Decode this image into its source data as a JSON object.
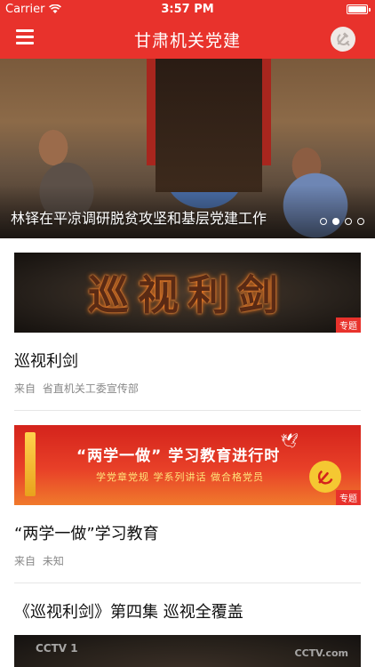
{
  "status_bar": {
    "carrier": "Carrier",
    "time": "3:57 PM"
  },
  "nav": {
    "title": "甘肃机关党建",
    "menu_icon": "hamburger-menu-icon",
    "right_icon": "hammer-sickle-icon"
  },
  "banner": {
    "caption": "林铎在平凉调研脱贫攻坚和基层党建工作",
    "page_count": 4,
    "active_index": 1
  },
  "feed": {
    "items": [
      {
        "title": "巡视利剑",
        "image_text": "巡视利剑",
        "tag": "专题",
        "source_label": "来自",
        "source": "省直机关工委宣传部"
      },
      {
        "title": "“两学一做”学习教育",
        "image_headline": "“两学一做” 学习教育进行时",
        "image_sub": "学党章党规   学系列讲话   做合格党员",
        "tag": "专题",
        "source_label": "来自",
        "source": "未知"
      },
      {
        "title": "《巡视利剑》第四集 巡视全覆盖",
        "logo_left": "CCTV 1",
        "logo_right": "CCTV.com"
      }
    ]
  },
  "colors": {
    "brand_red": "#e8322c"
  }
}
